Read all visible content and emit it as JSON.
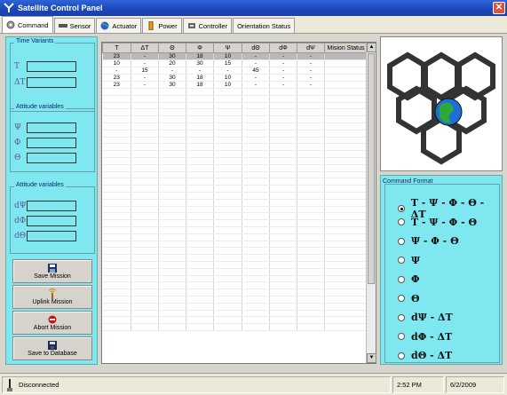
{
  "window": {
    "title": "Satellite Control Panel",
    "close_label": "✕"
  },
  "tabs": [
    {
      "label": "Command",
      "icon": "gear-icon"
    },
    {
      "label": "Sensor",
      "icon": "sensor-icon"
    },
    {
      "label": "Actuator",
      "icon": "globe-icon"
    },
    {
      "label": "Power",
      "icon": "battery-icon"
    },
    {
      "label": "Controller",
      "icon": "controller-icon"
    },
    {
      "label": "Orientation Status",
      "icon": ""
    }
  ],
  "time_variants": {
    "title": "Time Variants",
    "vars": [
      {
        "label": "T",
        "value": ""
      },
      {
        "label": "ΔT",
        "value": ""
      }
    ]
  },
  "attitude_variables": {
    "title": "Attitude variables",
    "vars": [
      {
        "label": "Ψ",
        "value": ""
      },
      {
        "label": "Φ",
        "value": ""
      },
      {
        "label": "Θ",
        "value": ""
      }
    ]
  },
  "attitude_rates": {
    "title": "Attitude variables",
    "vars": [
      {
        "label": "dΨ",
        "value": ""
      },
      {
        "label": "dΦ",
        "value": ""
      },
      {
        "label": "dΘ",
        "value": ""
      }
    ]
  },
  "actions": [
    {
      "label": "Save Mission",
      "icon": "save-icon"
    },
    {
      "label": "Uplink Mission",
      "icon": "antenna-icon"
    },
    {
      "label": "Abort Mission",
      "icon": "stop-icon"
    },
    {
      "label": "Save to Database",
      "icon": "database-icon"
    }
  ],
  "grid": {
    "columns": [
      "T",
      "ΔT",
      "Θ",
      "Φ",
      "Ψ",
      "dΘ",
      "dΦ",
      "dΨ",
      "Mision Status"
    ],
    "rows": [
      [
        "23",
        "-",
        "30",
        "18",
        "10",
        "-",
        "-",
        "-",
        ""
      ],
      [
        "10",
        "-",
        "20",
        "30",
        "15",
        "-",
        "-",
        "-",
        ""
      ],
      [
        "-",
        "15",
        "-",
        "-",
        "-",
        "45",
        "-",
        "-",
        ""
      ],
      [
        "23",
        "-",
        "30",
        "18",
        "10",
        "-",
        "-",
        "-",
        ""
      ],
      [
        "23",
        "-",
        "30",
        "18",
        "10",
        "-",
        "-",
        "-",
        ""
      ]
    ],
    "selected_row": 0,
    "empty_rows": 35
  },
  "command_format": {
    "title": "Command Format",
    "options": [
      {
        "label": "T - Ψ - Φ - Θ - ΔT",
        "checked": true
      },
      {
        "label": "T - Ψ - Φ - Θ",
        "checked": false
      },
      {
        "label": "Ψ - Φ - Θ",
        "checked": false
      },
      {
        "label": "Ψ",
        "checked": false
      },
      {
        "label": "Φ",
        "checked": false
      },
      {
        "label": "Θ",
        "checked": false
      },
      {
        "label": "dΨ - ΔT",
        "checked": false
      },
      {
        "label": "dΦ - ΔT",
        "checked": false
      },
      {
        "label": "dΘ - ΔT",
        "checked": false
      }
    ]
  },
  "status": {
    "connection": "Disconnected",
    "time": "2:52 PM",
    "date": "6/2/2009"
  },
  "colors": {
    "panel": "#7fe7ef",
    "titlebar": "#1a46b8",
    "earth_ocean": "#1d6fd8",
    "earth_land": "#2fa83a"
  }
}
